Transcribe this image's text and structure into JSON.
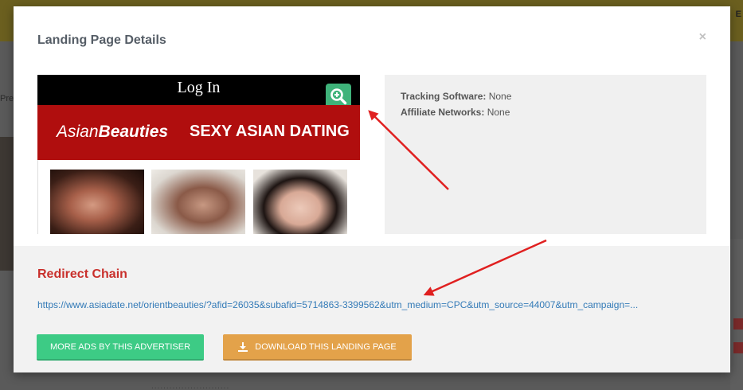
{
  "background": {
    "topbar_edge_text": "E",
    "left_text": "Pre",
    "bottom_text": "..........................",
    "colors": {
      "overlay": "#5a5a5a",
      "topbar": "#6b5f1f"
    }
  },
  "modal": {
    "title": "Landing Page Details",
    "close_label": "×"
  },
  "preview": {
    "login_text": "Log In",
    "brand_regular": "Asian",
    "brand_bold": "Beauties",
    "tagline": "SEXY ASIAN DATING",
    "zoom_icon": "zoom-in-icon",
    "colors": {
      "topbar": "#000000",
      "banner": "#b00e0e",
      "zoom": "#3fb37a"
    }
  },
  "info": {
    "tracking_label": "Tracking Software:",
    "tracking_value": "None",
    "affiliate_label": "Affiliate Networks:",
    "affiliate_value": "None"
  },
  "redirect": {
    "title": "Redirect Chain",
    "url": "https://www.asiadate.net/orientbeauties/?afid=26035&subafid=5714863-3399562&utm_medium=CPC&utm_source=44007&utm_campaign=..."
  },
  "buttons": {
    "more_ads": "MORE ADS BY THIS ADVERTISER",
    "download": "DOWNLOAD THIS LANDING PAGE",
    "download_icon": "download-icon",
    "colors": {
      "more_ads": "#3dcb85",
      "download": "#e3a24a"
    }
  },
  "annotations": {
    "arrow_color": "#e02020"
  }
}
